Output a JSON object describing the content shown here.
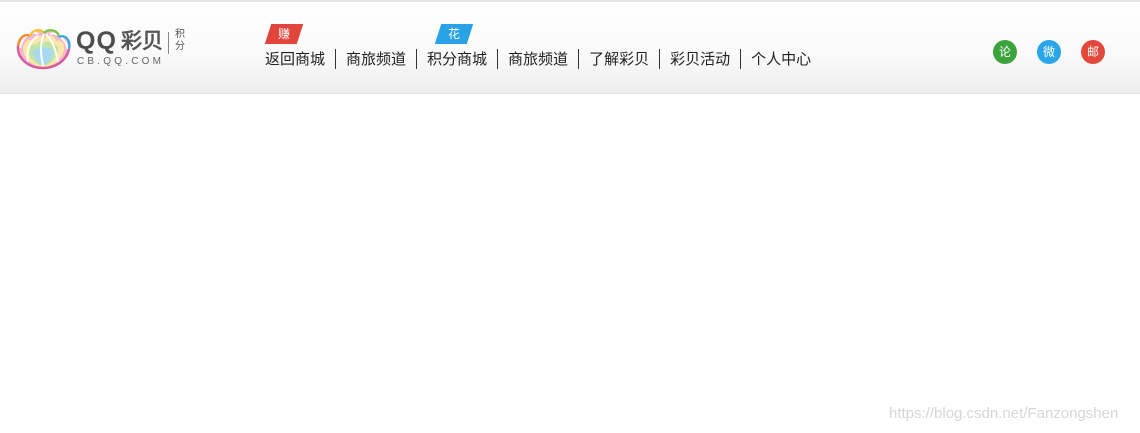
{
  "logo": {
    "brand": "QQ",
    "name_cn": "彩贝",
    "suffix_line1": "积",
    "suffix_line2": "分",
    "domain": "CB.QQ.COM"
  },
  "badges": {
    "earn": "赚",
    "spend": "花"
  },
  "nav": {
    "items": [
      {
        "label": "返回商城"
      },
      {
        "label": "商旅频道"
      },
      {
        "label": "积分商城"
      },
      {
        "label": "商旅频道"
      },
      {
        "label": "了解彩贝"
      },
      {
        "label": "彩贝活动"
      },
      {
        "label": "个人中心"
      }
    ]
  },
  "social": {
    "forum": "论",
    "weibo": "微",
    "mail": "邮"
  },
  "watermark": "https://blog.csdn.net/Fanzongshen",
  "colors": {
    "earn_badge": "#e2453b",
    "spend_badge": "#2aa3e6",
    "forum_icon": "#3da33c",
    "weibo_icon": "#2aa6e8",
    "mail_icon": "#e2483b"
  }
}
